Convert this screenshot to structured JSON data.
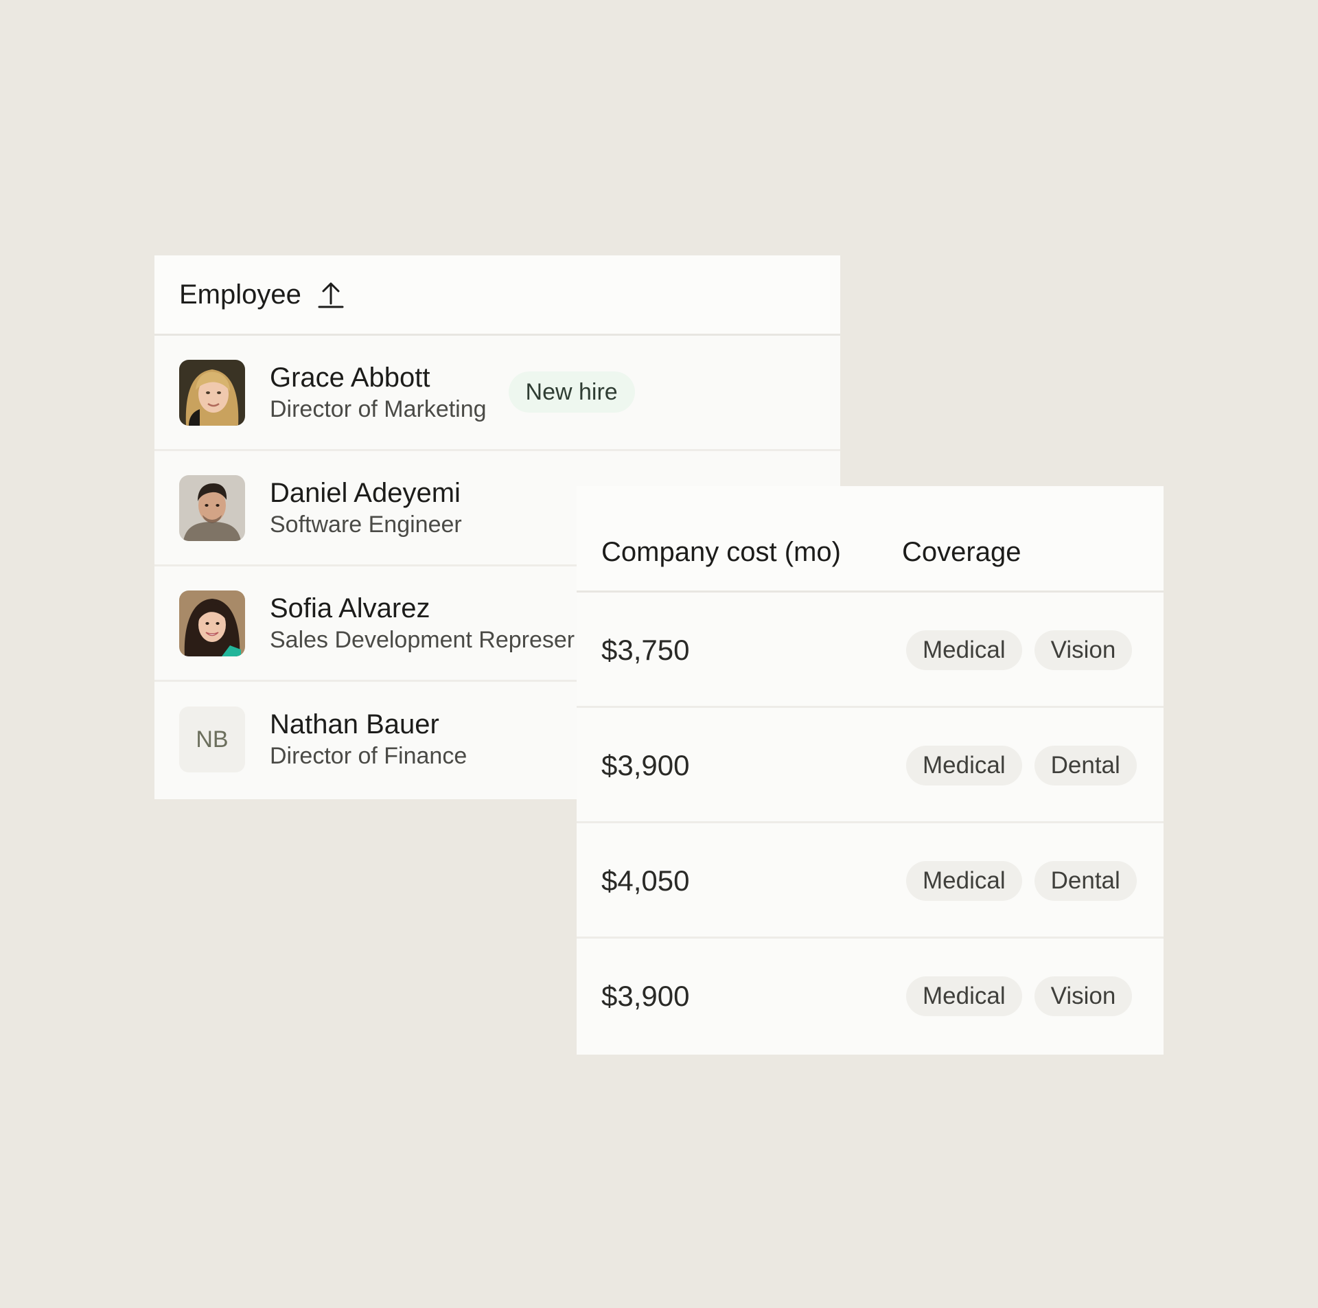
{
  "employee_table": {
    "header": "Employee",
    "sort_icon": "arrow-up-icon",
    "rows": [
      {
        "name": "Grace Abbott",
        "title": "Director of Marketing",
        "badge": "New hire",
        "avatar": "photo"
      },
      {
        "name": "Daniel Adeyemi",
        "title": "Software Engineer",
        "avatar": "photo"
      },
      {
        "name": "Sofia Alvarez",
        "title": "Sales Development Represer",
        "avatar": "photo"
      },
      {
        "name": "Nathan Bauer",
        "title": "Director of Finance",
        "avatar": "initials",
        "initials": "NB"
      }
    ]
  },
  "cost_table": {
    "headers": {
      "cost": "Company cost (mo)",
      "coverage": "Coverage"
    },
    "rows": [
      {
        "cost": "$3,750",
        "coverage": [
          "Medical",
          "Vision"
        ]
      },
      {
        "cost": "$3,900",
        "coverage": [
          "Medical",
          "Dental"
        ]
      },
      {
        "cost": "$4,050",
        "coverage": [
          "Medical",
          "Dental"
        ]
      },
      {
        "cost": "$3,900",
        "coverage": [
          "Medical",
          "Vision"
        ]
      }
    ]
  },
  "colors": {
    "background": "#ebe8e1",
    "card": "#fafaf8",
    "new_hire_badge": "#eef7ef",
    "coverage_pill": "#f0efeb"
  }
}
